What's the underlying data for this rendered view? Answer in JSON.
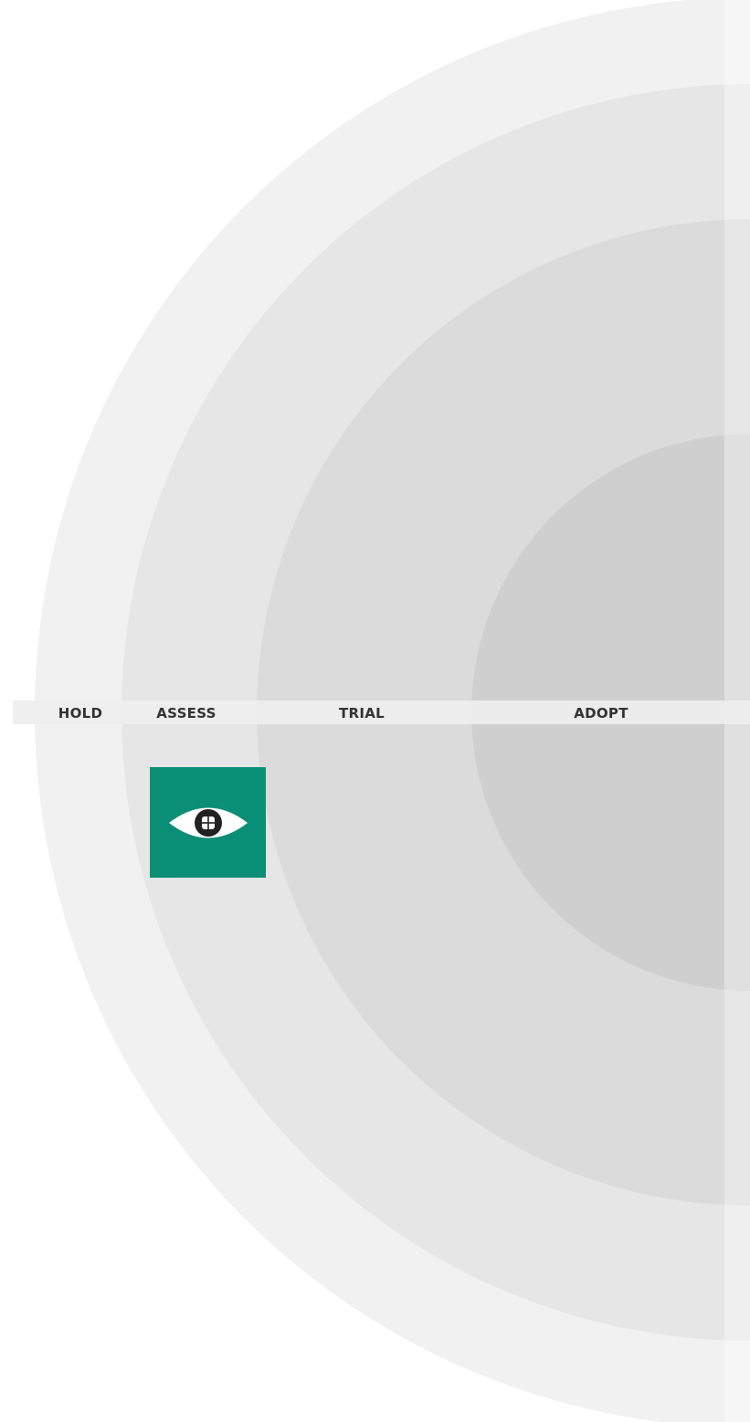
{
  "radar": {
    "rings": [
      {
        "label": "HOLD",
        "color": "#f1f1f1"
      },
      {
        "label": "ASSESS",
        "color": "#e6e6e6"
      },
      {
        "label": "TRIAL",
        "color": "#dbdbdb"
      },
      {
        "label": "ADOPT",
        "color": "#cfcfcf"
      }
    ],
    "axis_band_color": "#eeeeee",
    "label_color": "#333333"
  },
  "blip": {
    "icon": "eye-icon",
    "ring": "ASSESS",
    "color": "#0a8f76"
  }
}
